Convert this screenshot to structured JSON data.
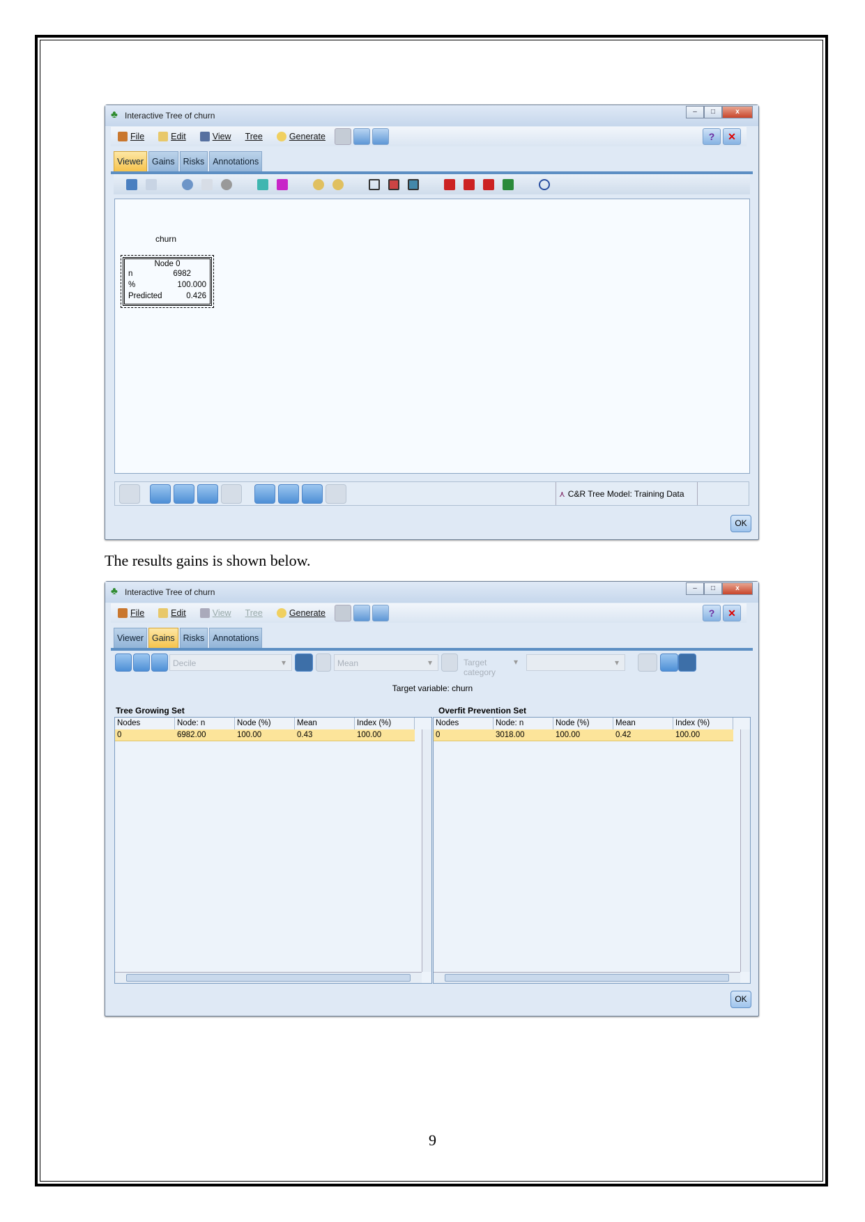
{
  "window1": {
    "title": "Interactive Tree of churn",
    "menu": [
      {
        "label": "File",
        "icon": "file-icon"
      },
      {
        "label": "Edit",
        "icon": "edit-icon"
      },
      {
        "label": "View",
        "icon": "view-icon"
      },
      {
        "label": "Tree"
      },
      {
        "label": "Generate",
        "icon": "generate-icon"
      }
    ],
    "tabs": [
      "Viewer",
      "Gains",
      "Risks",
      "Annotations"
    ],
    "active_tab": "Viewer",
    "tree": {
      "target": "churn",
      "node_title": "Node 0",
      "rows": [
        {
          "label": "n",
          "value": "6982"
        },
        {
          "label": "%",
          "value": "100.000"
        },
        {
          "label": "Predicted",
          "value": "0.426"
        }
      ]
    },
    "status": "C&R Tree Model: Training Data",
    "ok": "OK"
  },
  "caption": "The results gains is shown below.",
  "window2": {
    "title": "Interactive Tree of churn",
    "menu": [
      {
        "label": "File"
      },
      {
        "label": "Edit"
      },
      {
        "label": "View",
        "disabled": true
      },
      {
        "label": "Tree",
        "disabled": true
      },
      {
        "label": "Generate"
      }
    ],
    "tabs": [
      "Viewer",
      "Gains",
      "Risks",
      "Annotations"
    ],
    "active_tab": "Gains",
    "decile_placeholder": "Decile",
    "mean_placeholder": "Mean",
    "target_category_placeholder": "Target category",
    "target_variable": "Target variable: churn",
    "tables": [
      {
        "title": "Tree Growing Set",
        "columns": [
          "Nodes",
          "Node: n",
          "Node (%)",
          "Mean",
          "Index (%)"
        ],
        "rows": [
          [
            "0",
            "6982.00",
            "100.00",
            "0.43",
            "100.00"
          ]
        ]
      },
      {
        "title": "Overfit Prevention Set",
        "columns": [
          "Nodes",
          "Node: n",
          "Node (%)",
          "Mean",
          "Index (%)"
        ],
        "rows": [
          [
            "0",
            "3018.00",
            "100.00",
            "0.42",
            "100.00"
          ]
        ]
      }
    ],
    "ok": "OK"
  },
  "page_number": "9",
  "colors": {
    "active_tab": "#f6c34c",
    "selected_row": "#fce49a",
    "accent": "#5d8fc3"
  }
}
